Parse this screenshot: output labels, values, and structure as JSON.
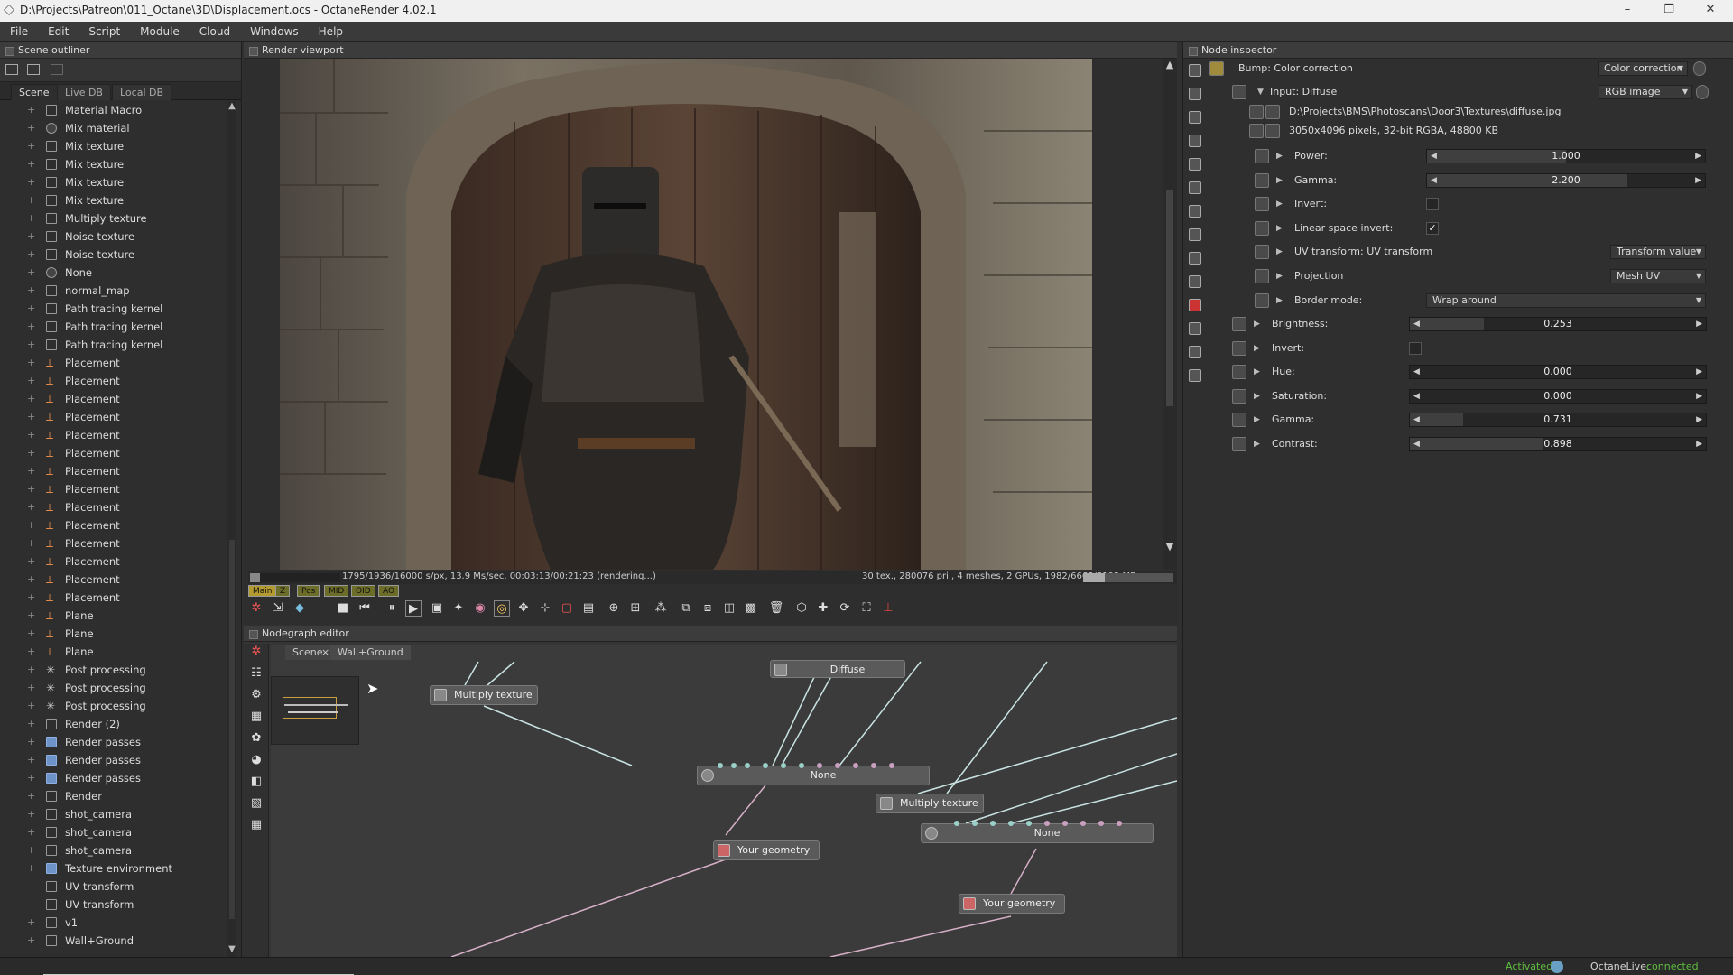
{
  "window": {
    "title": "D:\\Projects\\Patreon\\011_Octane\\3D\\Displacement.ocs - OctaneRender 4.02.1",
    "minimize": "–",
    "maximize": "❐",
    "close": "✕"
  },
  "menu": [
    "File",
    "Edit",
    "Script",
    "Module",
    "Cloud",
    "Windows",
    "Help"
  ],
  "outliner": {
    "title": "Scene outliner",
    "tabs": [
      "Scene",
      "Live DB",
      "Local DB"
    ],
    "items": [
      {
        "label": "Material Macro",
        "icon": "macro-icon"
      },
      {
        "label": "Mix material",
        "icon": "material-icon"
      },
      {
        "label": "Mix texture",
        "icon": "texture-icon"
      },
      {
        "label": "Mix texture",
        "icon": "texture-icon"
      },
      {
        "label": "Mix texture",
        "icon": "texture-icon"
      },
      {
        "label": "Mix texture",
        "icon": "texture-icon"
      },
      {
        "label": "Multiply texture",
        "icon": "texture-icon"
      },
      {
        "label": "Noise texture",
        "icon": "texture-icon"
      },
      {
        "label": "Noise texture",
        "icon": "texture-icon"
      },
      {
        "label": "None",
        "icon": "material-icon"
      },
      {
        "label": "normal_map",
        "icon": "image-icon"
      },
      {
        "label": "Path tracing kernel",
        "icon": "kernel-icon"
      },
      {
        "label": "Path tracing kernel",
        "icon": "kernel-icon"
      },
      {
        "label": "Path tracing kernel",
        "icon": "kernel-icon"
      },
      {
        "label": "Placement",
        "icon": "placement-icon"
      },
      {
        "label": "Placement",
        "icon": "placement-icon"
      },
      {
        "label": "Placement",
        "icon": "placement-icon"
      },
      {
        "label": "Placement",
        "icon": "placement-icon"
      },
      {
        "label": "Placement",
        "icon": "placement-icon"
      },
      {
        "label": "Placement",
        "icon": "placement-icon"
      },
      {
        "label": "Placement",
        "icon": "placement-icon"
      },
      {
        "label": "Placement",
        "icon": "placement-icon"
      },
      {
        "label": "Placement",
        "icon": "placement-icon"
      },
      {
        "label": "Placement",
        "icon": "placement-icon"
      },
      {
        "label": "Placement",
        "icon": "placement-icon"
      },
      {
        "label": "Placement",
        "icon": "placement-icon"
      },
      {
        "label": "Placement",
        "icon": "placement-icon"
      },
      {
        "label": "Placement",
        "icon": "placement-icon"
      },
      {
        "label": "Plane",
        "icon": "plane-icon"
      },
      {
        "label": "Plane",
        "icon": "plane-icon"
      },
      {
        "label": "Plane",
        "icon": "plane-icon"
      },
      {
        "label": "Post processing",
        "icon": "post-icon"
      },
      {
        "label": "Post processing",
        "icon": "post-icon"
      },
      {
        "label": "Post processing",
        "icon": "post-icon"
      },
      {
        "label": "Render (2)",
        "icon": "render-icon"
      },
      {
        "label": "Render passes",
        "icon": "passes-icon"
      },
      {
        "label": "Render passes",
        "icon": "passes-icon"
      },
      {
        "label": "Render passes",
        "icon": "passes-icon"
      },
      {
        "label": "Render",
        "icon": "render-icon"
      },
      {
        "label": "shot_camera",
        "icon": "camera-icon"
      },
      {
        "label": "shot_camera",
        "icon": "camera-icon"
      },
      {
        "label": "shot_camera",
        "icon": "camera-icon"
      },
      {
        "label": "Texture environment",
        "icon": "environment-icon"
      },
      {
        "label": "UV transform",
        "icon": "transform-icon"
      },
      {
        "label": "UV transform",
        "icon": "transform-icon"
      },
      {
        "label": "v1",
        "icon": "macro-icon"
      },
      {
        "label": "Wall+Ground",
        "icon": "macro-icon"
      }
    ]
  },
  "viewport": {
    "title": "Render viewport",
    "status_left": "1795/1936/16000 s/px, 13.9 Ms/sec, 00:03:13/00:21:23 (rendering...)",
    "status_right": "30 tex., 280076 pri., 4 meshes, 2 GPUs, 1982/6663/8192 MB",
    "progress": 0.11,
    "pass_tabs": [
      "Main",
      "Z",
      "Pos",
      "MID",
      "OID",
      "AO"
    ]
  },
  "nodegraph": {
    "title": "Nodegraph editor",
    "tabs": [
      "Scene",
      "Wall+Ground"
    ],
    "tab_close": "×",
    "nodes": {
      "multiply1": "Multiply texture",
      "diffuse": "Diffuse",
      "none1": "None",
      "multiply2": "Multiply texture",
      "none2": "None",
      "geo1": "Your geometry",
      "geo2": "Your geometry"
    }
  },
  "inspector": {
    "title": "Node inspector",
    "node_name": "Bump: Color correction",
    "node_type": "Color correction",
    "input_label": "Input: Diffuse",
    "input_type": "RGB image",
    "file_path": "D:\\Projects\\BMS\\Photoscans\\Door3\\Textures\\diffuse.jpg",
    "file_info": "3050x4096 pixels, 32-bit RGBA, 48800 KB",
    "image_params": [
      {
        "label": "Power:",
        "kind": "slider",
        "value": "1.000",
        "fraction": 0.5
      },
      {
        "label": "Gamma:",
        "kind": "slider",
        "value": "2.200",
        "fraction": 0.72
      },
      {
        "label": "Invert:",
        "kind": "check",
        "value": ""
      },
      {
        "label": "Linear space invert:",
        "kind": "check",
        "value": "✓"
      },
      {
        "label": "UV transform: UV transform",
        "kind": "drop",
        "value": "Transform value"
      },
      {
        "label": "Projection",
        "kind": "drop",
        "value": "Mesh UV"
      },
      {
        "label": "Border mode:",
        "kind": "wide",
        "value": "Wrap around"
      }
    ],
    "cc_params": [
      {
        "label": "Brightness:",
        "kind": "slider",
        "value": "0.253",
        "fraction": 0.25
      },
      {
        "label": "Invert:",
        "kind": "check",
        "value": ""
      },
      {
        "label": "Hue:",
        "kind": "slider",
        "value": "0.000",
        "fraction": 0.0
      },
      {
        "label": "Saturation:",
        "kind": "slider",
        "value": "0.000",
        "fraction": 0.0
      },
      {
        "label": "Gamma:",
        "kind": "slider",
        "value": "0.731",
        "fraction": 0.18
      },
      {
        "label": "Contrast:",
        "kind": "slider",
        "value": "0.898",
        "fraction": 0.45
      }
    ]
  },
  "status": {
    "activated": "Activated",
    "octanelive_label": "OctaneLive:",
    "octanelive_state": "connected",
    "accent": "#5fbf3f"
  }
}
